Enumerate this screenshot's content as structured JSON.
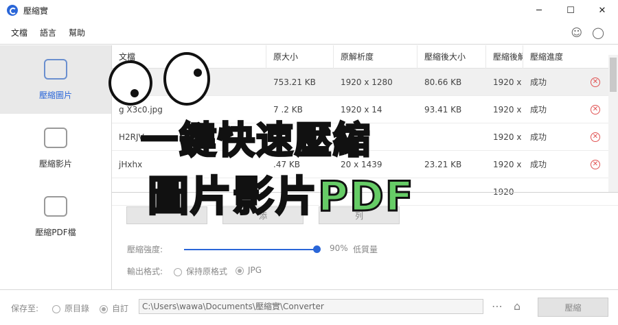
{
  "window": {
    "title": "壓縮實",
    "minimize": "─",
    "maximize": "☐",
    "close": "✕"
  },
  "menu": [
    "文檔",
    "語言",
    "幫助"
  ],
  "sidebar": [
    {
      "label": "壓縮圖片",
      "icon": "camera-icon",
      "active": true
    },
    {
      "label": "壓縮影片",
      "icon": "video-icon",
      "active": false
    },
    {
      "label": "壓縮PDF檔",
      "icon": "pdf-icon",
      "active": false
    }
  ],
  "table": {
    "headers": [
      "文檔",
      "原大小",
      "原解析度",
      "壓縮後大小",
      "壓縮後解",
      "壓縮進度"
    ],
    "rows": [
      {
        "name": "",
        "size": "753.21 KB",
        "res": "1920 x 1280",
        "csize": "80.66 KB",
        "cres": "1920 x",
        "status": "成功"
      },
      {
        "name": "g      X3c0.jpg",
        "size": "7  .2 KB",
        "res": "1920 x 14",
        "csize": "93.41 KB",
        "cres": "1920 x",
        "status": "成功"
      },
      {
        "name": "H2RJV",
        "size": "",
        "res": "",
        "csize": "",
        "cres": "1920 x",
        "status": "成功"
      },
      {
        "name": "jHxhx",
        "size": "  .47 KB",
        "res": "  20 x 1439",
        "csize": "23.21 KB",
        "cres": "1920 x",
        "status": "成功"
      },
      {
        "name": "",
        "size": "",
        "res": "",
        "csize": "",
        "cres": "1920",
        "status": ""
      }
    ]
  },
  "buttons": {
    "add": "添",
    "list": "列"
  },
  "compression": {
    "label": "壓縮強度:",
    "value": "90%",
    "quality": "低質量",
    "level": 0.9
  },
  "output": {
    "label": "輸出格式:",
    "keep": "保持原格式",
    "jpg": "JPG"
  },
  "footer": {
    "save_label": "保存至:",
    "orig_dir": "原目錄",
    "custom": "自訂",
    "path": "C:\\Users\\wawa\\Documents\\壓縮實\\Converter",
    "compress": "壓縮"
  },
  "overlay": {
    "line1": "一鍵快速壓縮",
    "line2": "圖片影片PDF"
  }
}
